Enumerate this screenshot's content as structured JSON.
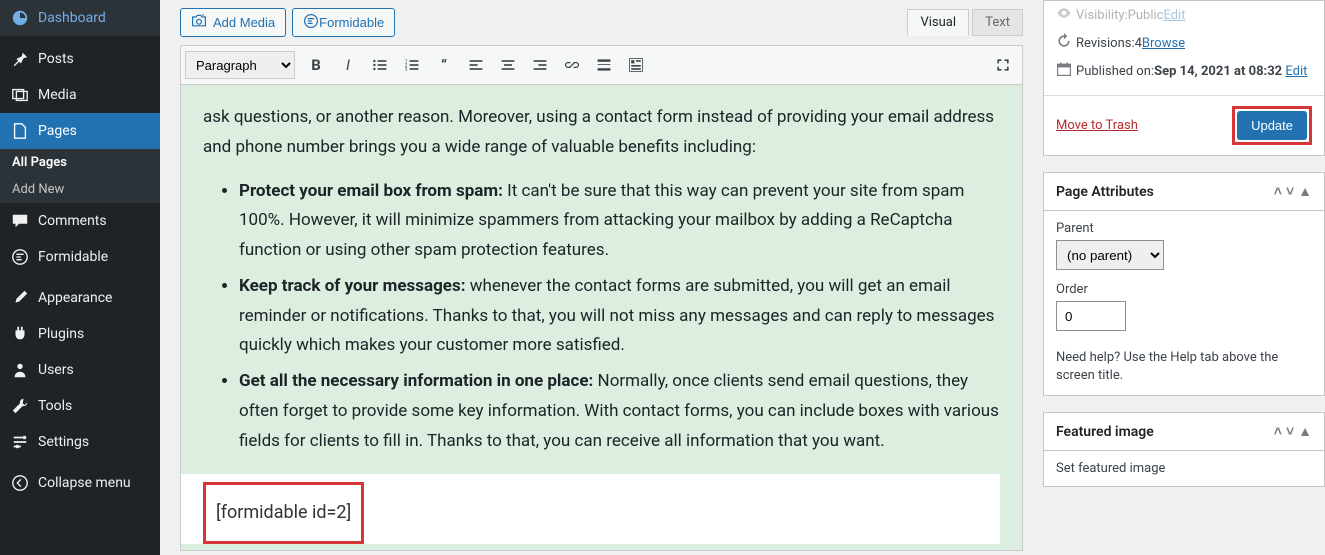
{
  "sidebar": {
    "dashboard": "Dashboard",
    "posts": "Posts",
    "media": "Media",
    "pages": "Pages",
    "all_pages": "All Pages",
    "add_new": "Add New",
    "comments": "Comments",
    "formidable": "Formidable",
    "appearance": "Appearance",
    "plugins": "Plugins",
    "users": "Users",
    "tools": "Tools",
    "settings": "Settings",
    "collapse": "Collapse menu"
  },
  "editor": {
    "add_media": "Add Media",
    "formidable": "Formidable",
    "tab_visual": "Visual",
    "tab_text": "Text",
    "paragraph": "Paragraph"
  },
  "content": {
    "para1": "ask questions, or another reason. Moreover, using a contact form instead of providing your email address and phone number brings you a wide range of valuable benefits including:",
    "b1_strong": "Protect your email box from spam:",
    "b1_text": " It can't be sure that this way can prevent your site from spam 100%. However, it will minimize spammers from attacking your mailbox by adding a ReCaptcha function or using other spam protection features.",
    "b2_strong": "Keep track of your messages:",
    "b2_text": " whenever the contact forms are submitted, you will get an email reminder or notifications. Thanks to that, you will not miss any messages and can reply to messages quickly which makes your customer more satisfied.",
    "b3_strong": "Get all the necessary information in one place:",
    "b3_text": " Normally, once clients send email questions, they often forget to provide some key information. With contact forms, you can include boxes with various fields for clients to fill in. Thanks to that, you can receive all information that you want.",
    "shortcode": "[formidable id=2]"
  },
  "publish": {
    "visibility_label": "Visibility: ",
    "visibility_value": "Public ",
    "edit": "Edit",
    "revisions_label": "Revisions: ",
    "revisions_count": "4 ",
    "browse": "Browse",
    "published_label": "Published on: ",
    "published_date": "Sep 14, 2021 at 08:32",
    "trash": "Move to Trash",
    "update": "Update"
  },
  "attrs": {
    "title": "Page Attributes",
    "parent_label": "Parent",
    "parent_value": "(no parent)",
    "order_label": "Order",
    "order_value": "0",
    "help": "Need help? Use the Help tab above the screen title."
  },
  "featured": {
    "title": "Featured image",
    "link": "Set featured image"
  }
}
